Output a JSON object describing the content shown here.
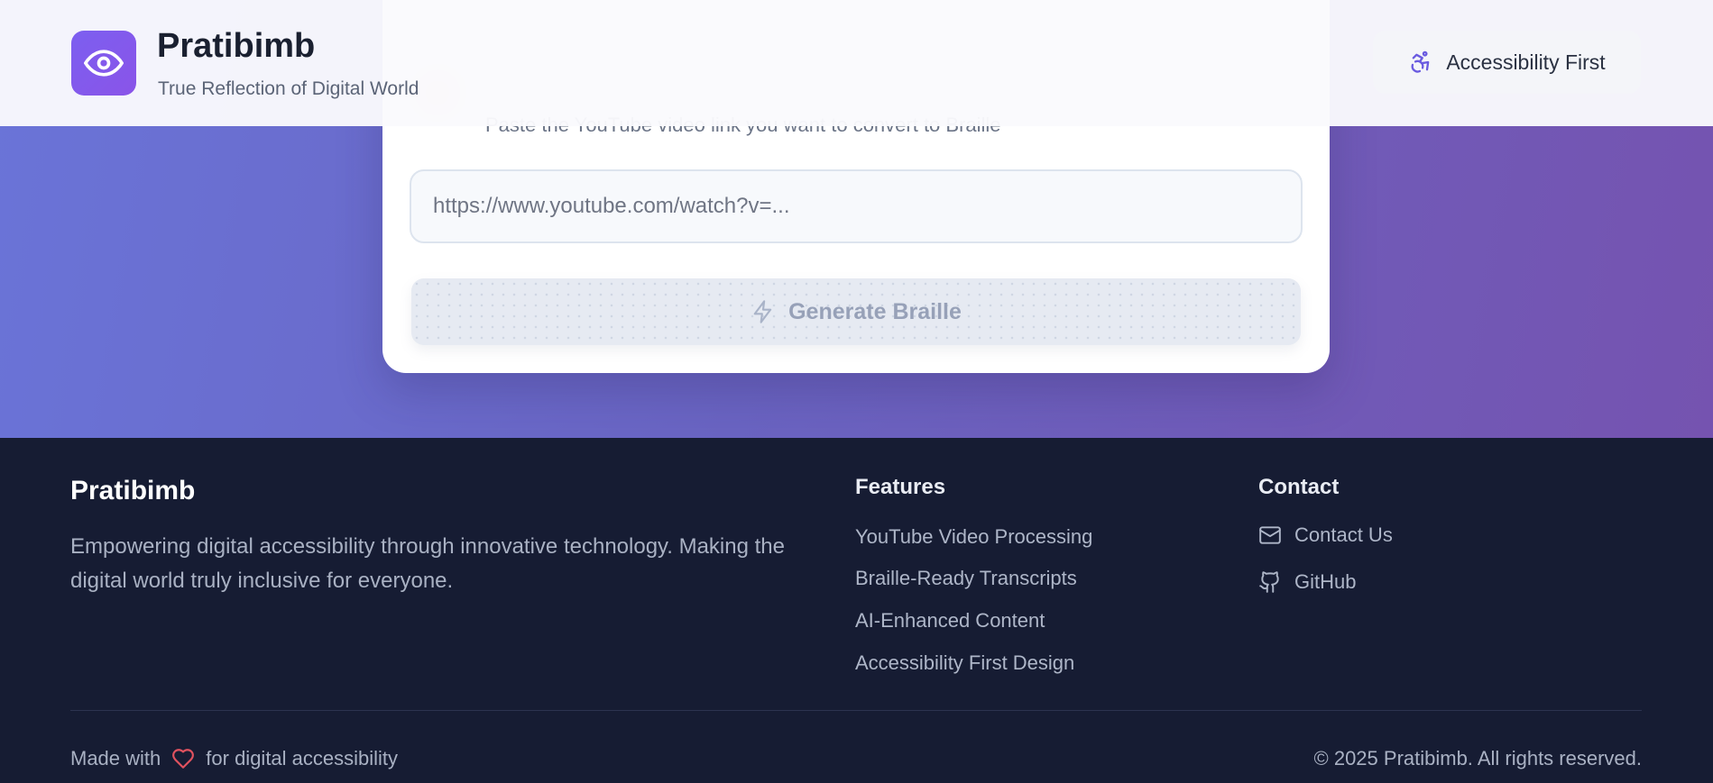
{
  "header": {
    "brand": "Pratibimb",
    "tagline": "True Reflection of Digital World",
    "accessibility_button": "Accessibility First",
    "logo_icon": "eye-icon"
  },
  "converter": {
    "hint": "Paste the YouTube video link you want to convert to Braille",
    "url_placeholder": "https://www.youtube.com/watch?v=...",
    "generate_label": "Generate Braille",
    "generate_icon": "zap-icon"
  },
  "footer": {
    "brand": "Pratibimb",
    "description": "Empowering digital accessibility through innovative technology. Making the digital world truly inclusive for everyone.",
    "features_title": "Features",
    "features": [
      "YouTube Video Processing",
      "Braille-Ready Transcripts",
      "AI-Enhanced Content",
      "Accessibility First Design"
    ],
    "contact_title": "Contact",
    "contact_links": [
      "Contact Us",
      "GitHub"
    ],
    "made_with_prefix": "Made with",
    "made_with_suffix": "for digital accessibility",
    "copyright": "© 2025 Pratibimb. All rights reserved."
  },
  "colors": {
    "hero_start": "#6a74d8",
    "hero_end": "#7553b0",
    "logo_bg": "#7c5ff0",
    "footer_bg": "#161c33",
    "heart": "#e0525f"
  }
}
